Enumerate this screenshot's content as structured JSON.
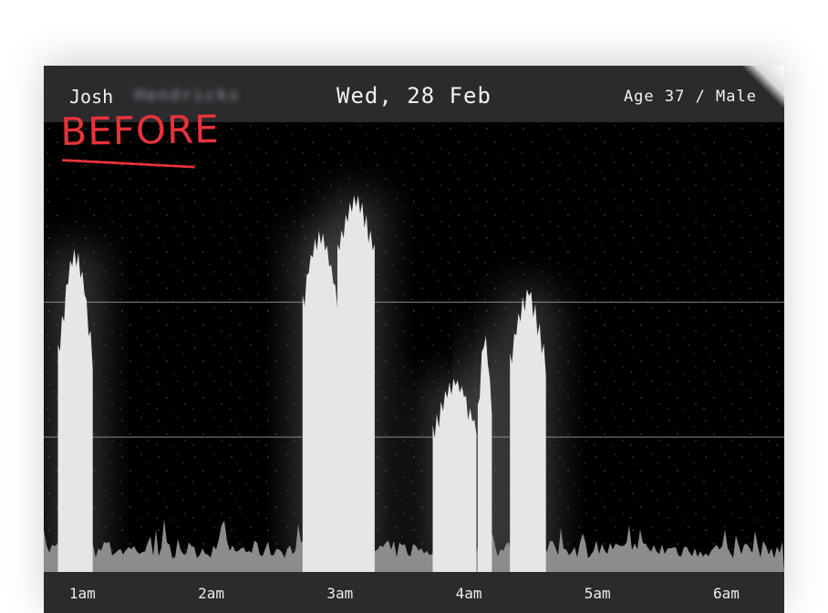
{
  "header": {
    "first_name": "Josh",
    "last_name_redacted": "Hendricks",
    "date": "Wed, 28 Feb",
    "demographics": "Age 37 / Male"
  },
  "annotation": {
    "text": "BEFORE",
    "color": "#e8323a"
  },
  "colors": {
    "background": "#000000",
    "header_bar": "#2b2b2e",
    "activity_high": "#e6e6e6",
    "activity_low": "#8c8c8c",
    "gridline": "#8a8a8a"
  },
  "chart_data": {
    "type": "area",
    "title": "",
    "xlabel": "",
    "ylabel": "",
    "x_ticks": [
      "1am",
      "2am",
      "3am",
      "4am",
      "5am",
      "6am"
    ],
    "xlim": [
      0.7,
      6.45
    ],
    "ylim": [
      0,
      1
    ],
    "grid": {
      "horizontal_lines": [
        0.3,
        0.6
      ]
    },
    "baseline_noise": {
      "level": 0.05,
      "amplitude": 0.04
    },
    "series": [
      {
        "values_description_free": true,
        "x_start": 0.0,
        "x_end": 0.0,
        "bursts": [
          {
            "x_start": 0.81,
            "x_end": 1.08,
            "peak": 0.72,
            "base": 0.45
          },
          {
            "x_start": 2.71,
            "x_end": 2.98,
            "peak": 0.76,
            "base": 0.58
          },
          {
            "x_start": 2.98,
            "x_end": 3.27,
            "peak": 0.84,
            "base": 0.7
          },
          {
            "x_start": 3.72,
            "x_end": 4.06,
            "peak": 0.43,
            "base": 0.3
          },
          {
            "x_start": 4.07,
            "x_end": 4.18,
            "peak": 0.53,
            "base": 0.33
          },
          {
            "x_start": 4.32,
            "x_end": 4.6,
            "peak": 0.63,
            "base": 0.45
          }
        ]
      }
    ]
  }
}
